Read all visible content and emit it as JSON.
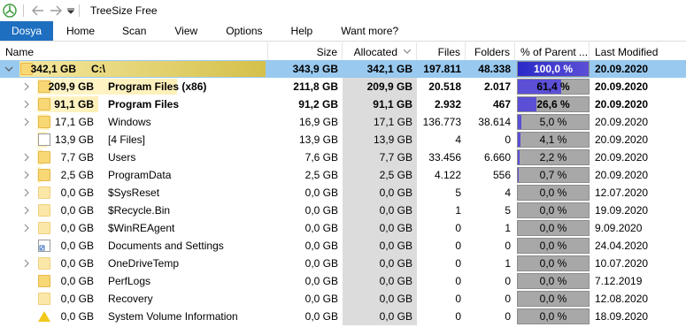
{
  "app": {
    "title": "TreeSize Free",
    "back_icon": "arrow-left-icon",
    "forward_icon": "arrow-right-icon"
  },
  "ribbon": {
    "tabs": [
      {
        "label": "Dosya",
        "active": true
      },
      {
        "label": "Home"
      },
      {
        "label": "Scan"
      },
      {
        "label": "View"
      },
      {
        "label": "Options"
      },
      {
        "label": "Help"
      },
      {
        "label": "Want more?"
      }
    ]
  },
  "columns": {
    "name": "Name",
    "size": "Size",
    "allocated": "Allocated",
    "files": "Files",
    "folders": "Folders",
    "percent": "% of Parent ...",
    "modified": "Last Modified"
  },
  "colors": {
    "selection": "#99c9ef",
    "ribbon_file_tab": "#1e6fc0",
    "percent_fill": "#5b4fd6",
    "percent_bar_bg": "#a8a8a8",
    "size_bar_top": "#d4c04a",
    "size_bar_child": "#fff0b8"
  },
  "rows": [
    {
      "expander": "down",
      "icon": "drive-icon",
      "name_size": "342,1 GB",
      "name": "C:\\",
      "size": "343,9 GB",
      "allocated": "342,1 GB",
      "files": "197.811",
      "folders": "48.338",
      "percent": "100,0 %",
      "percent_value": 100.0,
      "modified": "20.09.2020",
      "bold": true,
      "selected": true,
      "level": 0,
      "bar_frac": 1.0
    },
    {
      "expander": "right",
      "icon": "folder-icon",
      "name_size": "209,9 GB",
      "name": "Program Files (x86)",
      "size": "211,8 GB",
      "allocated": "209,9 GB",
      "files": "20.518",
      "folders": "2.017",
      "percent": "61,4 %",
      "percent_value": 61.4,
      "modified": "20.09.2020",
      "bold": true,
      "level": 1,
      "bar_frac": 0.614
    },
    {
      "expander": "right",
      "icon": "folder-icon",
      "name_size": "91,1 GB",
      "name": "Program Files",
      "size": "91,2 GB",
      "allocated": "91,1 GB",
      "files": "2.932",
      "folders": "467",
      "percent": "26,6 %",
      "percent_value": 26.6,
      "modified": "20.09.2020",
      "bold": true,
      "level": 1,
      "bar_frac": 0.266
    },
    {
      "expander": "right",
      "icon": "folder-icon",
      "name_size": "17,1 GB",
      "name": "Windows",
      "size": "16,9 GB",
      "allocated": "17,1 GB",
      "files": "136.773",
      "folders": "38.614",
      "percent": "5,0 %",
      "percent_value": 5.0,
      "modified": "20.09.2020",
      "bold": false,
      "level": 1,
      "bar_frac": 0.05
    },
    {
      "expander": "none",
      "icon": "file-icon",
      "name_size": "13,9 GB",
      "name": "[4 Files]",
      "size": "13,9 GB",
      "allocated": "13,9 GB",
      "files": "4",
      "folders": "0",
      "percent": "4,1 %",
      "percent_value": 4.1,
      "modified": "20.09.2020",
      "bold": false,
      "level": 1,
      "bar_frac": 0.041
    },
    {
      "expander": "right",
      "icon": "folder-icon",
      "name_size": "7,7 GB",
      "name": "Users",
      "size": "7,6 GB",
      "allocated": "7,7 GB",
      "files": "33.456",
      "folders": "6.660",
      "percent": "2,2 %",
      "percent_value": 2.2,
      "modified": "20.09.2020",
      "bold": false,
      "level": 1,
      "bar_frac": 0.022
    },
    {
      "expander": "right",
      "icon": "folder-icon",
      "name_size": "2,5 GB",
      "name": "ProgramData",
      "size": "2,5 GB",
      "allocated": "2,5 GB",
      "files": "4.122",
      "folders": "556",
      "percent": "0,7 %",
      "percent_value": 0.7,
      "modified": "20.09.2020",
      "bold": false,
      "level": 1,
      "bar_frac": 0.007
    },
    {
      "expander": "right",
      "icon": "folder-light-icon",
      "name_size": "0,0 GB",
      "name": "$SysReset",
      "size": "0,0 GB",
      "allocated": "0,0 GB",
      "files": "5",
      "folders": "4",
      "percent": "0,0 %",
      "percent_value": 0.0,
      "modified": "12.07.2020",
      "bold": false,
      "level": 1,
      "bar_frac": 0.0
    },
    {
      "expander": "right",
      "icon": "folder-light-icon",
      "name_size": "0,0 GB",
      "name": "$Recycle.Bin",
      "size": "0,0 GB",
      "allocated": "0,0 GB",
      "files": "1",
      "folders": "5",
      "percent": "0,0 %",
      "percent_value": 0.0,
      "modified": "19.09.2020",
      "bold": false,
      "level": 1,
      "bar_frac": 0.0
    },
    {
      "expander": "right",
      "icon": "folder-light-icon",
      "name_size": "0,0 GB",
      "name": "$WinREAgent",
      "size": "0,0 GB",
      "allocated": "0,0 GB",
      "files": "0",
      "folders": "1",
      "percent": "0,0 %",
      "percent_value": 0.0,
      "modified": "9.09.2020",
      "bold": false,
      "level": 1,
      "bar_frac": 0.0
    },
    {
      "expander": "none",
      "icon": "shortcut-icon",
      "name_size": "0,0 GB",
      "name": "Documents and Settings",
      "size": "0,0 GB",
      "allocated": "0,0 GB",
      "files": "0",
      "folders": "0",
      "percent": "0,0 %",
      "percent_value": 0.0,
      "modified": "24.04.2020",
      "bold": false,
      "level": 1,
      "bar_frac": 0.0
    },
    {
      "expander": "right",
      "icon": "folder-light-icon",
      "name_size": "0,0 GB",
      "name": "OneDriveTemp",
      "size": "0,0 GB",
      "allocated": "0,0 GB",
      "files": "0",
      "folders": "1",
      "percent": "0,0 %",
      "percent_value": 0.0,
      "modified": "10.07.2020",
      "bold": false,
      "level": 1,
      "bar_frac": 0.0
    },
    {
      "expander": "none",
      "icon": "folder-icon",
      "name_size": "0,0 GB",
      "name": "PerfLogs",
      "size": "0,0 GB",
      "allocated": "0,0 GB",
      "files": "0",
      "folders": "0",
      "percent": "0,0 %",
      "percent_value": 0.0,
      "modified": "7.12.2019",
      "bold": false,
      "level": 1,
      "bar_frac": 0.0
    },
    {
      "expander": "none",
      "icon": "folder-light-icon",
      "name_size": "0,0 GB",
      "name": "Recovery",
      "size": "0,0 GB",
      "allocated": "0,0 GB",
      "files": "0",
      "folders": "0",
      "percent": "0,0 %",
      "percent_value": 0.0,
      "modified": "12.08.2020",
      "bold": false,
      "level": 1,
      "bar_frac": 0.0
    },
    {
      "expander": "none",
      "icon": "warning-icon",
      "name_size": "0,0 GB",
      "name": "System Volume Information",
      "size": "0,0 GB",
      "allocated": "0,0 GB",
      "files": "0",
      "folders": "0",
      "percent": "0,0 %",
      "percent_value": 0.0,
      "modified": "18.09.2020",
      "bold": false,
      "level": 1,
      "bar_frac": 0.0
    }
  ]
}
